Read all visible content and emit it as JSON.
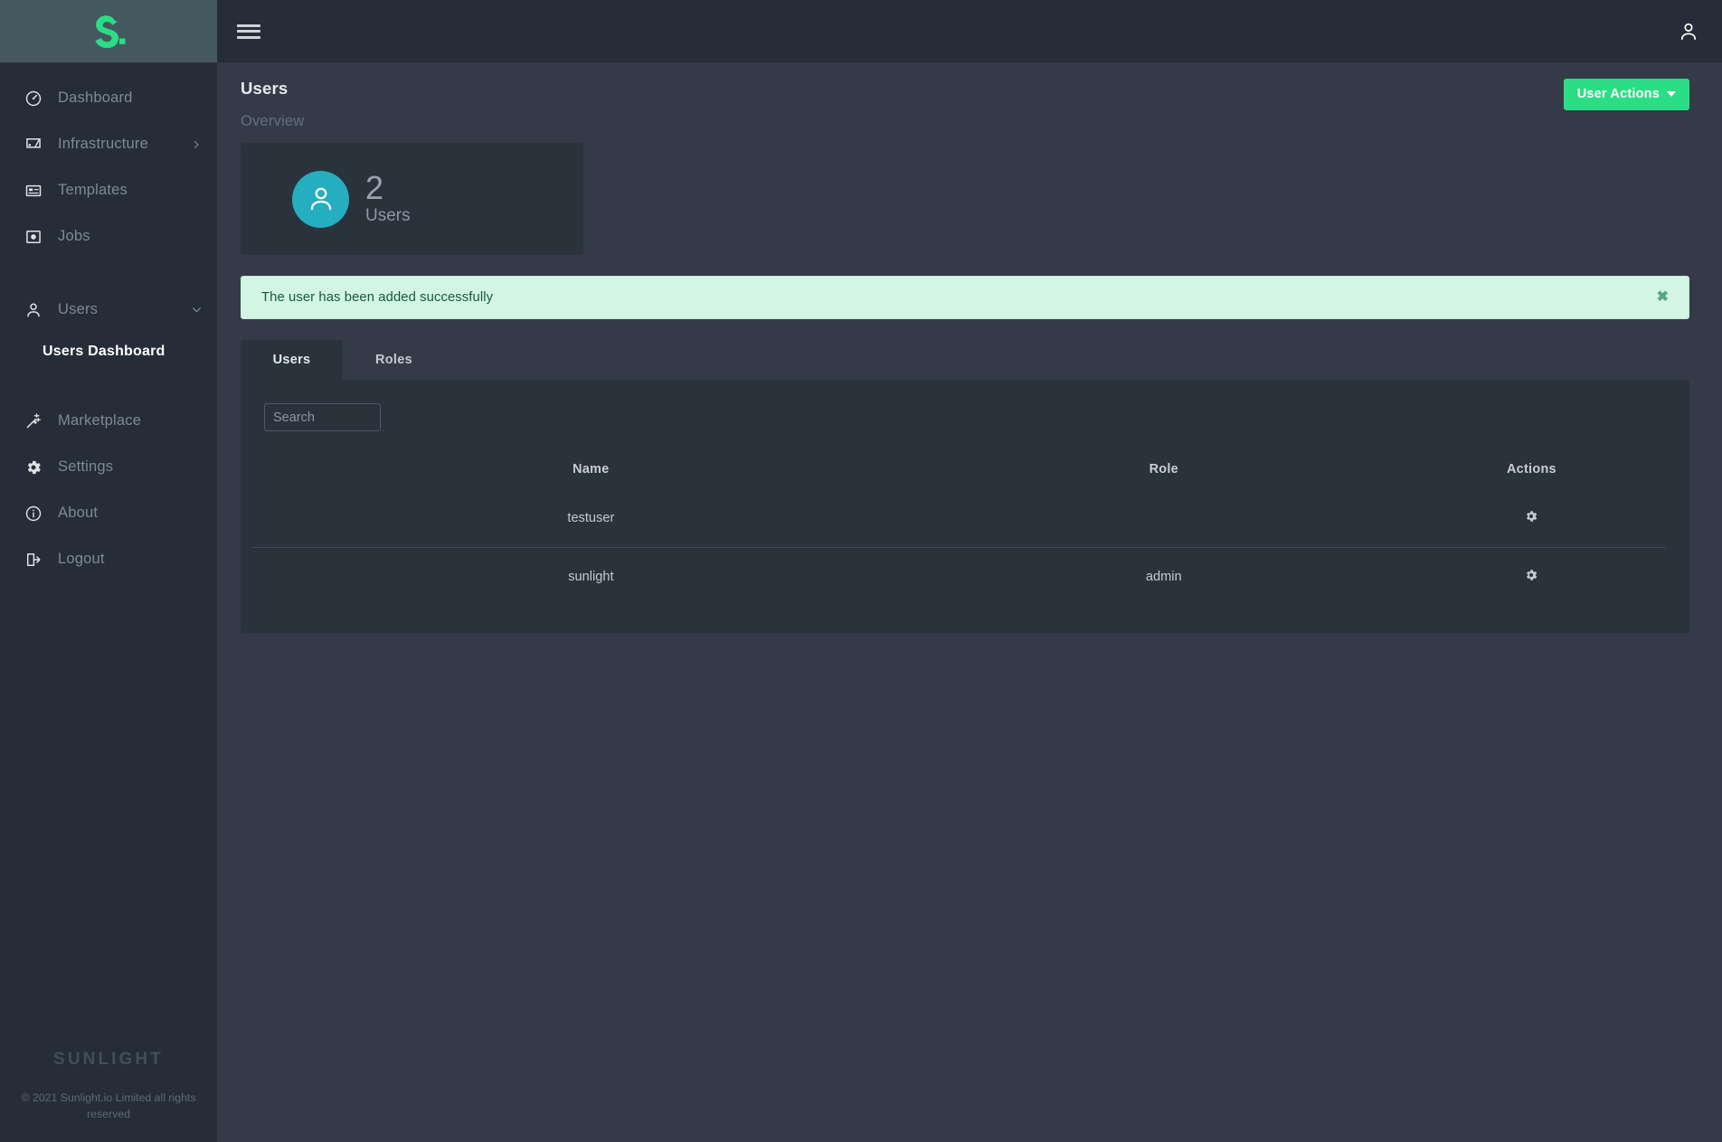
{
  "brand": {
    "logo_icon": "sunlight-s-logo",
    "accent_green": "#2bdd84",
    "teal": "#25adc0",
    "sidebar_bg": "#272d38",
    "page_bg": "#353a49",
    "card_bg": "#2a323c"
  },
  "sidebar": {
    "items": [
      {
        "label": "Dashboard",
        "icon": "speedometer-icon",
        "active": false,
        "caret": null
      },
      {
        "label": "Infrastructure",
        "icon": "server-icon",
        "active": false,
        "caret": "chevron-right"
      },
      {
        "label": "Templates",
        "icon": "template-card-icon",
        "active": false,
        "caret": null
      },
      {
        "label": "Jobs",
        "icon": "jobs-square-icon",
        "active": false,
        "caret": null
      },
      {
        "label": "Users",
        "icon": "user-icon",
        "active": false,
        "caret": "chevron-down"
      }
    ],
    "sub_items": [
      {
        "label": "Users Dashboard",
        "active": true
      }
    ],
    "items_lower": [
      {
        "label": "Marketplace",
        "icon": "magic-wand-icon"
      },
      {
        "label": "Settings",
        "icon": "gear-icon"
      },
      {
        "label": "About",
        "icon": "info-circle-icon"
      },
      {
        "label": "Logout",
        "icon": "logout-icon"
      }
    ],
    "footer": {
      "wordmark": "SUNLIGHT",
      "copyright": "© 2021 Sunlight.io Limited all rights reserved"
    }
  },
  "topbar": {
    "menu_icon": "hamburger-icon",
    "user_icon": "user-account-icon"
  },
  "page": {
    "title": "Users",
    "overview_label": "Overview",
    "user_actions_label": "User Actions"
  },
  "stat_card": {
    "icon": "user-avatar-icon",
    "value": "2",
    "caption": "Users"
  },
  "alert": {
    "message": "The user has been added successfully",
    "close_label": "✖",
    "type": "success"
  },
  "tabs": [
    {
      "label": "Users",
      "active": true
    },
    {
      "label": "Roles",
      "active": false
    }
  ],
  "search": {
    "value": "",
    "placeholder": "Search"
  },
  "table": {
    "headers": {
      "name": "Name",
      "role": "Role",
      "actions": "Actions"
    },
    "rows": [
      {
        "name": "testuser",
        "role": "",
        "action_icon": "gear-icon"
      },
      {
        "name": "sunlight",
        "role": "admin",
        "action_icon": "gear-icon"
      }
    ]
  }
}
